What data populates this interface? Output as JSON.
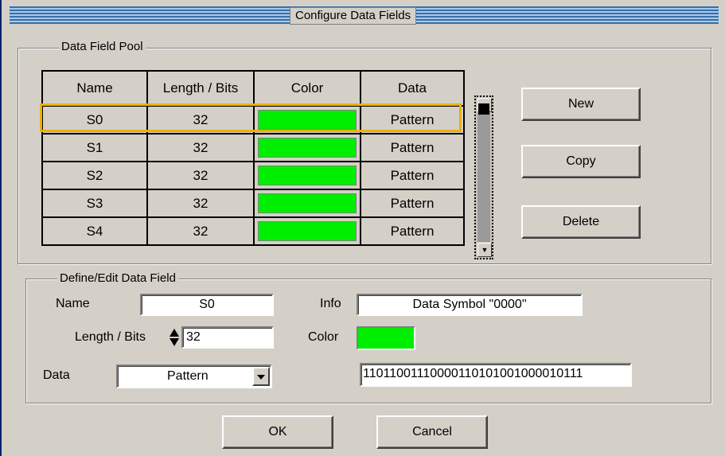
{
  "dialog": {
    "title": "Configure Data Fields"
  },
  "pool": {
    "legend": "Data Field Pool",
    "columns": [
      "Name",
      "Length / Bits",
      "Color",
      "Data"
    ],
    "rows": [
      {
        "name": "S0",
        "length": "32",
        "color": "#00ee00",
        "data": "Pattern"
      },
      {
        "name": "S1",
        "length": "32",
        "color": "#00ee00",
        "data": "Pattern"
      },
      {
        "name": "S2",
        "length": "32",
        "color": "#00ee00",
        "data": "Pattern"
      },
      {
        "name": "S3",
        "length": "32",
        "color": "#00ee00",
        "data": "Pattern"
      },
      {
        "name": "S4",
        "length": "32",
        "color": "#00ee00",
        "data": "Pattern"
      }
    ],
    "selected_row": "S0",
    "highlight_color": "#f0b000",
    "buttons": {
      "new": "New",
      "copy": "Copy",
      "delete": "Delete"
    }
  },
  "edit": {
    "legend": "Define/Edit Data Field",
    "name_label": "Name",
    "name_value": "S0",
    "info_label": "Info",
    "info_value": "Data Symbol \"0000\"",
    "length_label": "Length / Bits",
    "length_value": "32",
    "color_label": "Color",
    "color_value": "#00ee00",
    "data_label": "Data",
    "data_value": "Pattern",
    "pattern_value": "11011001110000110101001000010111"
  },
  "footer": {
    "ok": "OK",
    "cancel": "Cancel"
  }
}
